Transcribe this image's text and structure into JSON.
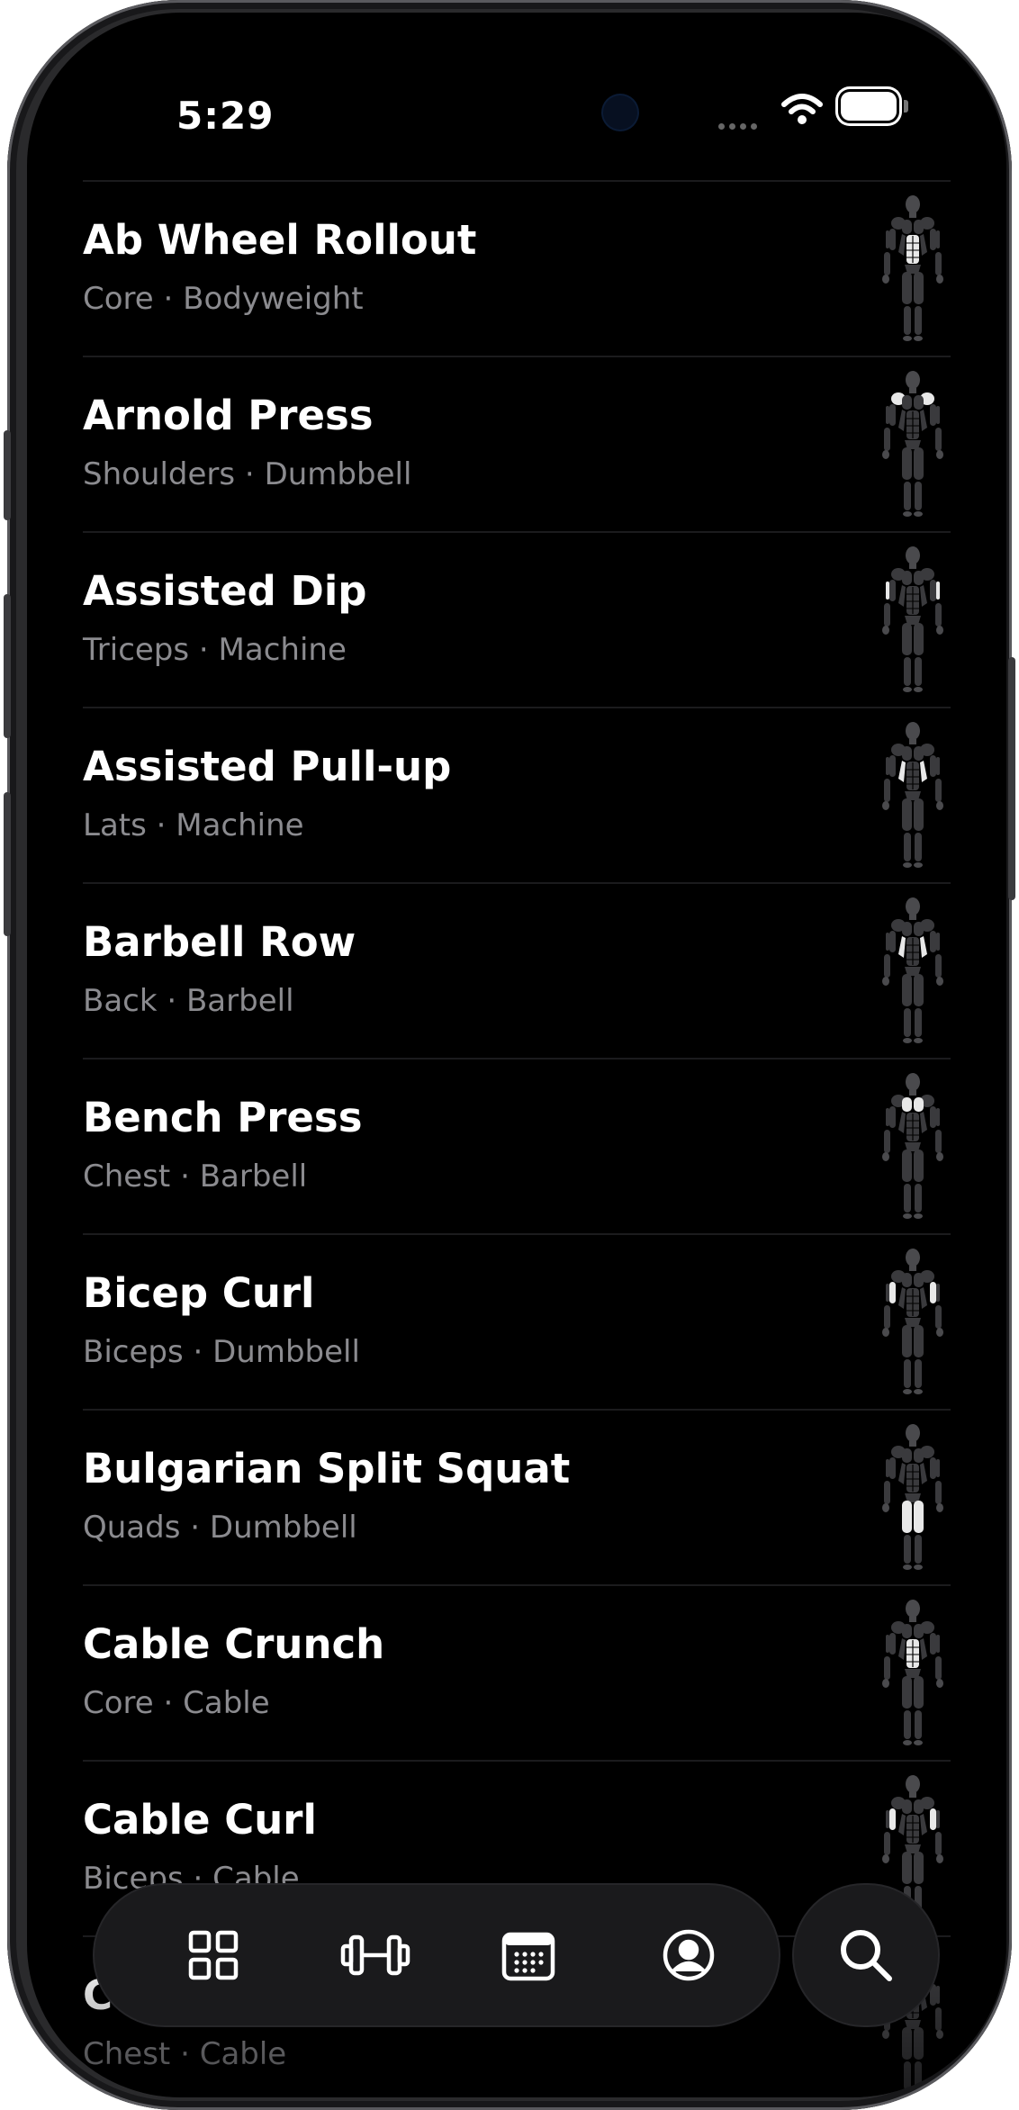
{
  "status_bar": {
    "time": "5:29"
  },
  "exercises": [
    {
      "name": "Ab Wheel Rollout",
      "muscle": "Core",
      "equipment": "Bodyweight",
      "sep": " · ",
      "highlight": "core"
    },
    {
      "name": "Arnold Press",
      "muscle": "Shoulders",
      "equipment": "Dumbbell",
      "sep": " · ",
      "highlight": "shoulders"
    },
    {
      "name": "Assisted Dip",
      "muscle": "Triceps",
      "equipment": "Machine",
      "sep": " · ",
      "highlight": "triceps"
    },
    {
      "name": "Assisted Pull-up",
      "muscle": "Lats",
      "equipment": "Machine",
      "sep": " · ",
      "highlight": "lats"
    },
    {
      "name": "Barbell Row",
      "muscle": "Back",
      "equipment": "Barbell",
      "sep": " · ",
      "highlight": "back"
    },
    {
      "name": "Bench Press",
      "muscle": "Chest",
      "equipment": "Barbell",
      "sep": " · ",
      "highlight": "chest"
    },
    {
      "name": "Bicep Curl",
      "muscle": "Biceps",
      "equipment": "Dumbbell",
      "sep": " · ",
      "highlight": "biceps"
    },
    {
      "name": "Bulgarian Split Squat",
      "muscle": "Quads",
      "equipment": "Dumbbell",
      "sep": " · ",
      "highlight": "quads"
    },
    {
      "name": "Cable Crunch",
      "muscle": "Core",
      "equipment": "Cable",
      "sep": " · ",
      "highlight": "core"
    },
    {
      "name": "Cable Curl",
      "muscle": "Biceps",
      "equipment": "Cable",
      "sep": " · ",
      "highlight": "biceps"
    },
    {
      "name": "Cable Fly",
      "muscle": "Chest",
      "equipment": "Cable",
      "sep": " · ",
      "highlight": "chest"
    }
  ],
  "nav": {
    "items": [
      {
        "icon": "grid-icon"
      },
      {
        "icon": "dumbbell-icon"
      },
      {
        "icon": "calendar-icon"
      },
      {
        "icon": "profile-icon"
      }
    ],
    "search_icon": "search-icon"
  },
  "colors": {
    "background": "#000000",
    "title": "#ffffff",
    "subtitle": "#8b8b8f",
    "nav_background": "#1a1a1c",
    "muscle_highlight": "#e8e8e8",
    "body_figure": "#3a3a3d"
  }
}
